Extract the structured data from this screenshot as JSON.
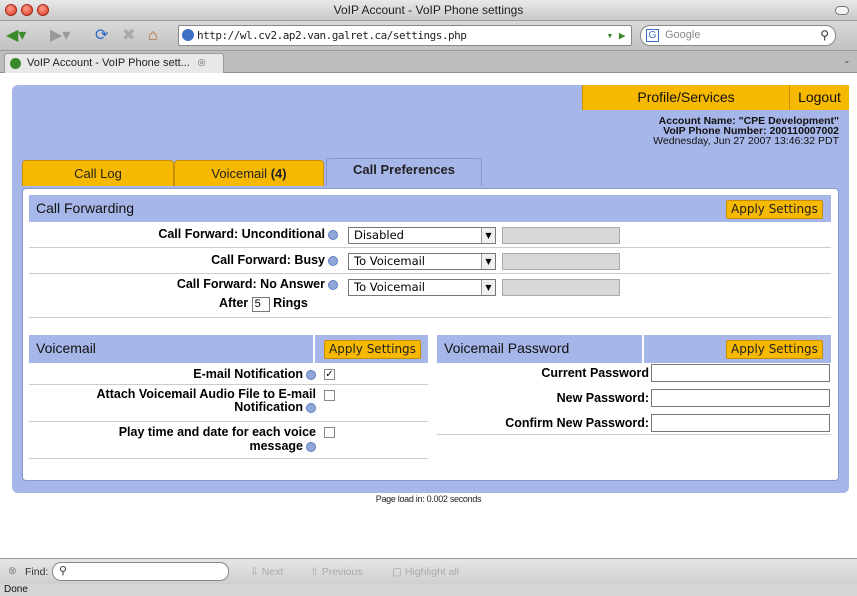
{
  "window": {
    "title": "VoIP Account - VoIP Phone settings"
  },
  "browser": {
    "url": "http://wl.cv2.ap2.van.galret.ca/settings.php",
    "search_placeholder": "Google",
    "tab_label": "VoIP Account - VoIP Phone sett...",
    "status": "Done"
  },
  "topnav": {
    "profile": "Profile/Services",
    "logout": "Logout"
  },
  "account": {
    "name_line": "Account Name: \"CPE Development\"",
    "number_line": "VoIP Phone Number: 200110007002",
    "datetime": "Wednesday, Jun 27 2007 13:46:32 PDT"
  },
  "tabs": {
    "calllog": "Call Log",
    "voicemail": "Voicemail",
    "voicemail_count": "(4)",
    "callpref": "Call Preferences"
  },
  "call_forwarding": {
    "title": "Call Forwarding",
    "apply": "Apply Settings",
    "unconditional_label": "Call Forward: Unconditional",
    "unconditional_value": "Disabled",
    "busy_label": "Call Forward: Busy",
    "busy_value": "To Voicemail",
    "noanswer_label": "Call Forward: No Answer",
    "noanswer_value": "To Voicemail",
    "after_label": "After",
    "rings_value": "5",
    "rings_label": "Rings"
  },
  "voicemail": {
    "title": "Voicemail",
    "apply": "Apply Settings",
    "email_notification": "E-mail Notification",
    "email_notification_checked": true,
    "attach_audio_1": "Attach Voicemail Audio File to E-mail",
    "attach_audio_2": "Notification",
    "play_time_1": "Play time and date for each voice",
    "play_time_2": "message"
  },
  "voicemail_password": {
    "title": "Voicemail Password",
    "apply": "Apply Settings",
    "current": "Current Password",
    "new": "New Password:",
    "confirm": "Confirm New Password:"
  },
  "footer": {
    "page_load": "Page load in: 0.002 seconds"
  },
  "findbar": {
    "find_label": "Find:",
    "next": "Next",
    "previous": "Previous",
    "highlight": "Highlight all"
  }
}
